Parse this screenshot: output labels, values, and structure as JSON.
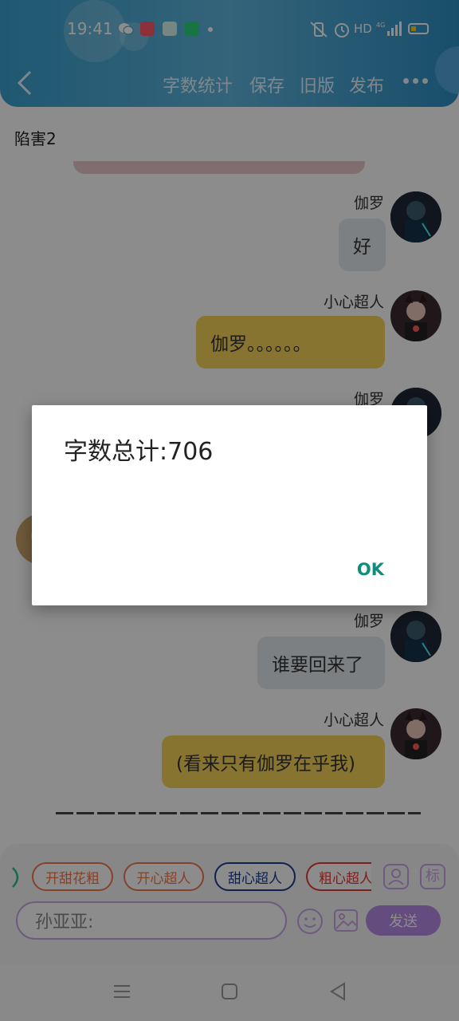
{
  "status_bar": {
    "time": "19:41",
    "network": "HD",
    "signal": "4G"
  },
  "toolbar": {
    "items": [
      "字数统计",
      "保存",
      "旧版",
      "发布"
    ]
  },
  "document": {
    "title": "陷害2"
  },
  "messages": [
    {
      "sender": "伽罗",
      "text": "好",
      "style": "gray"
    },
    {
      "sender": "小心超人",
      "text": "伽罗。。。。。。",
      "style": "gold"
    },
    {
      "sender": "伽罗",
      "text": "",
      "style": "gray"
    },
    {
      "sender": "伽罗",
      "text": "谁要回来了",
      "style": "gray"
    },
    {
      "sender": "小心超人",
      "text": "(看来只有伽罗在乎我)",
      "style": "gold"
    }
  ],
  "divider": "———————————————————",
  "role_chips": [
    {
      "label": "开甜花粗",
      "color": "#ef7b4e"
    },
    {
      "label": "开心超人",
      "color": "#ef7b4e"
    },
    {
      "label": "甜心超人",
      "color": "#1e3d8f"
    },
    {
      "label": "粗心超人",
      "color": "#e53935"
    }
  ],
  "side_buttons": [
    "person-icon",
    "标"
  ],
  "composer": {
    "value": "孙亚亚:",
    "send_label": "发送"
  },
  "dialog": {
    "message": "字数总计:706",
    "ok_label": "OK"
  },
  "colors": {
    "header": "#4aa9d6",
    "bubble_gold": "#f6d45a",
    "bubble_gray": "#e4e9ef",
    "accent_purple": "#b88ae8",
    "dialog_ok": "#0f8c7b"
  }
}
